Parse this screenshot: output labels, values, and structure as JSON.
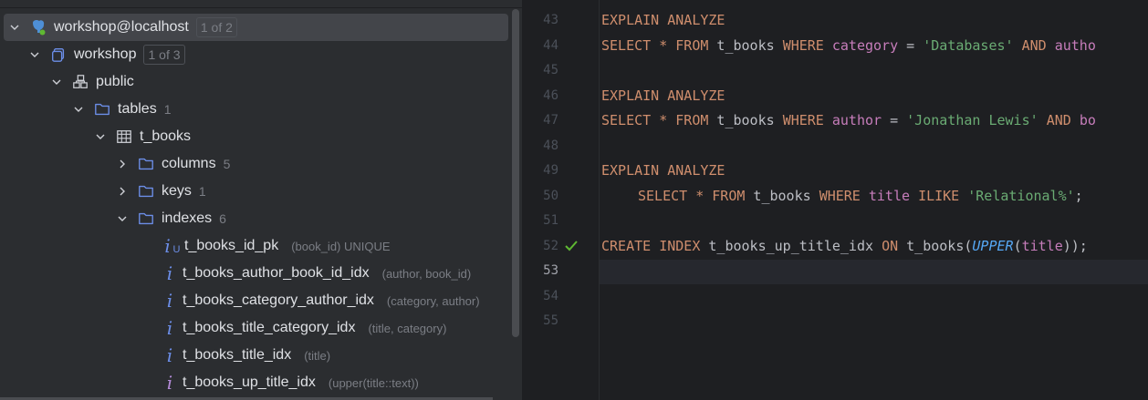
{
  "tree": {
    "rows": [
      {
        "label": "workshop@localhost",
        "badge": "1 of 2"
      },
      {
        "label": "workshop",
        "badge": "1 of 3"
      },
      {
        "label": "public"
      },
      {
        "label": "tables",
        "count": "1"
      },
      {
        "label": "t_books"
      },
      {
        "label": "columns",
        "count": "5"
      },
      {
        "label": "keys",
        "count": "1"
      },
      {
        "label": "indexes",
        "count": "6"
      }
    ],
    "indexes": [
      {
        "name": "t_books_id_pk",
        "detail": "(book_id) UNIQUE"
      },
      {
        "name": "t_books_author_book_id_idx",
        "detail": "(author, book_id)"
      },
      {
        "name": "t_books_category_author_idx",
        "detail": "(category, author)"
      },
      {
        "name": "t_books_title_category_idx",
        "detail": "(title, category)"
      },
      {
        "name": "t_books_title_idx",
        "detail": "(title)"
      },
      {
        "name": "t_books_up_title_idx",
        "detail": "(upper(title::text))"
      }
    ]
  },
  "editor": {
    "line_numbers": [
      "43",
      "44",
      "45",
      "46",
      "47",
      "48",
      "49",
      "50",
      "51",
      "52",
      "53",
      "54",
      "55"
    ],
    "current_line": "53",
    "code": {
      "l43": {
        "kw": "EXPLAIN ANALYZE"
      },
      "l44": {
        "k1": "SELECT",
        "star": " * ",
        "k2": "FROM",
        "t1": " t_books ",
        "k3": "WHERE",
        "t2": " ",
        "c1": "category",
        "t3": " = ",
        "s1": "'Databases'",
        "t4": " ",
        "k4": "AND",
        "t5": " ",
        "c2": "autho"
      },
      "l46": {
        "kw": "EXPLAIN ANALYZE"
      },
      "l47": {
        "k1": "SELECT",
        "star": " * ",
        "k2": "FROM",
        "t1": " t_books ",
        "k3": "WHERE",
        "t2": " ",
        "c1": "author",
        "t3": " = ",
        "s1": "'Jonathan Lewis'",
        "t4": " ",
        "k4": "AND",
        "t5": " ",
        "c2": "bo"
      },
      "l49": {
        "kw": "EXPLAIN ANALYZE"
      },
      "l50": {
        "k1": "SELECT",
        "star": " * ",
        "k2": "FROM",
        "t1": " t_books ",
        "k3": "WHERE",
        "t2": " ",
        "c1": "title",
        "t3": " ",
        "k4": "ILIKE",
        "t4": " ",
        "s1": "'Relational%'",
        "t5": ";"
      },
      "l52": {
        "k1": "CREATE INDEX",
        "t1": " t_books_up_title_idx ",
        "k2": "ON",
        "t2": " t_books(",
        "fn": "UPPER",
        "t3": "(",
        "c1": "title",
        "t4": "));"
      }
    }
  }
}
